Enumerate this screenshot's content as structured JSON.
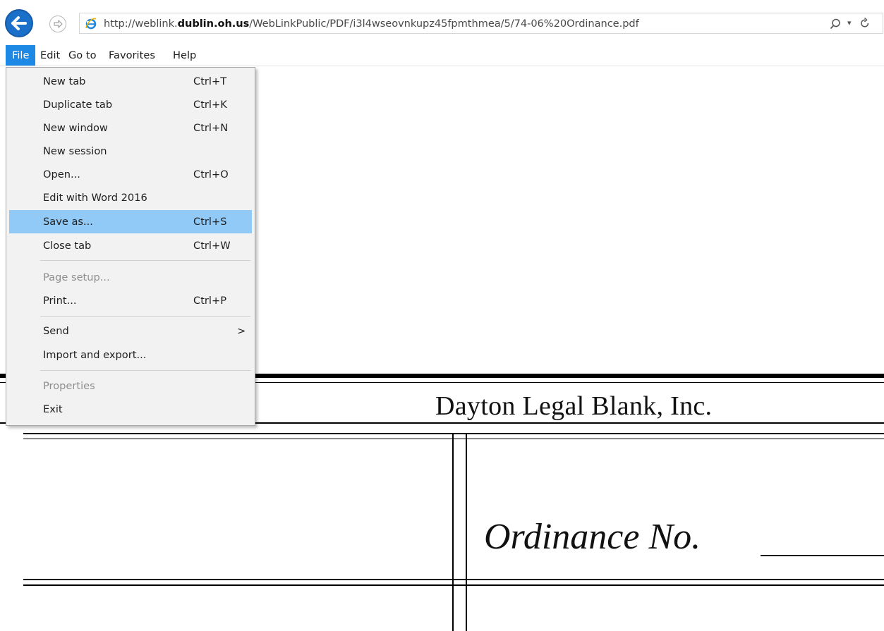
{
  "browser": {
    "url_prefix": "http://weblink.",
    "url_domain": "dublin.oh.us",
    "url_path": "/WebLinkPublic/PDF/i3l4wseovnkupz45fpmthmea/5/74-06%20Ordinance.pdf",
    "icons": [
      "back-arrow-icon",
      "forward-arrow-icon",
      "ie-logo-icon",
      "search-icon",
      "dropdown-arrow-icon",
      "refresh-icon"
    ]
  },
  "menubar": {
    "items": [
      {
        "label": "File"
      },
      {
        "label": "Edit"
      },
      {
        "label": "Go to"
      },
      {
        "label": "Favorites"
      },
      {
        "label": "Help"
      }
    ]
  },
  "file_menu": {
    "items": [
      {
        "label": "New tab",
        "shortcut": "Ctrl+T"
      },
      {
        "label": "Duplicate tab",
        "shortcut": "Ctrl+K"
      },
      {
        "label": "New window",
        "shortcut": "Ctrl+N"
      },
      {
        "label": "New session",
        "shortcut": ""
      },
      {
        "label": "Open...",
        "shortcut": "Ctrl+O"
      },
      {
        "label": "Edit with Word 2016",
        "shortcut": ""
      },
      {
        "label": "Save as...",
        "shortcut": "Ctrl+S",
        "state": "highlighted"
      },
      {
        "label": "Close tab",
        "shortcut": "Ctrl+W"
      },
      {
        "label": "Page setup...",
        "shortcut": "",
        "state": "disabled"
      },
      {
        "label": "Print...",
        "shortcut": "Ctrl+P"
      },
      {
        "label": "Send",
        "shortcut": "",
        "submenu_arrow": ">"
      },
      {
        "label": "Import and export...",
        "shortcut": ""
      },
      {
        "label": "Properties",
        "shortcut": "",
        "state": "disabled"
      },
      {
        "label": "Exit",
        "shortcut": ""
      }
    ]
  },
  "document": {
    "company": "Dayton Legal Blank, Inc.",
    "ordinance_label": "Ordinance No."
  },
  "colors": {
    "menu_active": "#1e88e5",
    "menu_highlight": "#91c9f7",
    "back_button": "#1a6fc9"
  }
}
